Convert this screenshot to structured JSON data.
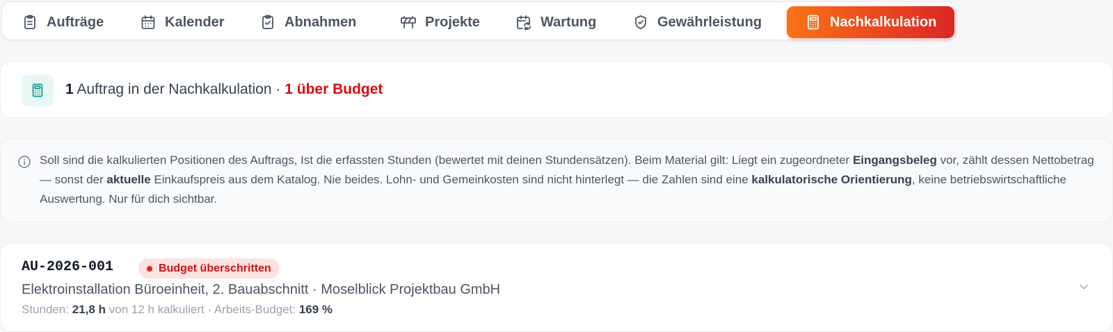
{
  "tabs": [
    {
      "label": "Aufträge",
      "icon": "clipboard-list-icon",
      "active": false
    },
    {
      "label": "Kalender",
      "icon": "calendar-icon",
      "active": false
    },
    {
      "label": "Abnahmen",
      "icon": "clipboard-check-icon",
      "active": false
    },
    {
      "label": "Projekte",
      "icon": "construction-barrier-icon",
      "active": false
    },
    {
      "label": "Wartung",
      "icon": "calendar-sync-icon",
      "active": false
    },
    {
      "label": "Gewährleistung",
      "icon": "shield-check-icon",
      "active": false
    },
    {
      "label": "Nachkalkulation",
      "icon": "calculator-icon",
      "active": true
    }
  ],
  "summary": {
    "icon": "calculator-icon",
    "count": "1",
    "text": "Auftrag in der Nachkalkulation",
    "separator": "·",
    "over_budget": "1 über Budget"
  },
  "info": {
    "icon": "info-icon",
    "part1": "Soll sind die kalkulierten Positionen des Auftrags, Ist die erfassten Stunden (bewertet mit deinen Stundensätzen). Beim Material gilt: Liegt ein zugeordneter ",
    "bold1": "Eingangsbeleg",
    "part2": " vor, zählt dessen Nettobetrag — sonst der ",
    "bold2": "aktuelle",
    "part3": " Einkaufspreis aus dem Katalog. Nie beides. Lohn‑ und Gemeinkosten sind nicht hinterlegt — die Zahlen sind eine ",
    "bold3": "kalkulatorische Orientierung",
    "part4": ", keine betriebswirtschaftliche Auswertung. Nur für dich sichtbar."
  },
  "order": {
    "id": "AU-2026-001",
    "badge": "Budget überschritten",
    "title": "Elektroinstallation Büroeinheit, 2. Bauabschnitt · Moselblick Projektbau GmbH",
    "hours_label": "Stunden:",
    "hours_value": "21,8 h",
    "hours_of": "von 12 h kalkuliert · Arbeits‑Budget:",
    "budget_value": "169 %"
  },
  "colors": {
    "accent_from": "#f97316",
    "accent_to": "#dc2626",
    "danger": "#d60e0e",
    "teal": "#0d9488"
  }
}
